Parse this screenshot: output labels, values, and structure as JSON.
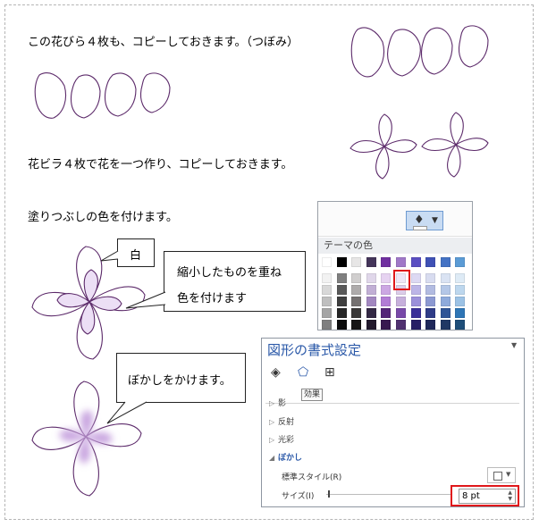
{
  "doc": {
    "line1": "この花びら４枚も、コピーしておきます。（つぼみ）",
    "line2": "花ビラ４枚で花を一つ作り、コピーしておきます。",
    "line3": "塗りつぶしの色を付けます。",
    "callout_white": "白",
    "callout_color_1": "縮小したものを重ね",
    "callout_color_2": "色を付けます",
    "callout_blur": "ぼかしをかけます。"
  },
  "palette": {
    "section_label": "テーマの色",
    "top_row": [
      "#ffffff",
      "#000000",
      "#e7e6e6",
      "#44355a",
      "#7030a0",
      "#a078c8",
      "#5b4fc2",
      "#3f51b5",
      "#4472c4",
      "#5b9bd5"
    ],
    "columns": [
      [
        "#f2f2f2",
        "#d8d8d8",
        "#bfbfbf",
        "#a5a5a5",
        "#7f7f7f"
      ],
      [
        "#7f7f7f",
        "#595959",
        "#3f3f3f",
        "#262626",
        "#0c0c0c"
      ],
      [
        "#d0cece",
        "#aeabab",
        "#757171",
        "#3a3838",
        "#171616"
      ],
      [
        "#e0d7ea",
        "#c1afd5",
        "#a287c0",
        "#332844",
        "#221a2d"
      ],
      [
        "#e6d3f1",
        "#cca7e3",
        "#b27cd5",
        "#542478",
        "#381850"
      ],
      [
        "#eee6f6",
        "#dccde9",
        "#c7b0dc",
        "#7849a8",
        "#503170"
      ],
      [
        "#ddd9f3",
        "#bcb5e7",
        "#9b90da",
        "#3a2f98",
        "#271f65"
      ],
      [
        "#d8dcf0",
        "#b2bbe1",
        "#8c99d2",
        "#2f3c87",
        "#1f285a"
      ],
      [
        "#dae3f3",
        "#b4c7e7",
        "#8eaadb",
        "#2f5496",
        "#1f3864"
      ],
      [
        "#deebf6",
        "#bdd7ee",
        "#9cc2e5",
        "#2e75b5",
        "#1e4e79"
      ]
    ]
  },
  "pane": {
    "title": "図形の書式設定",
    "tooltip": "効果",
    "sections": [
      "影",
      "反射",
      "光彩"
    ],
    "blur_header": "ぼかし",
    "preset_label": "標準スタイル(R)",
    "size_label": "サイズ(I)",
    "size_value": "8 pt",
    "tab_icons": [
      "fill-line-icon",
      "effects-pentagon-icon",
      "size-properties-icon"
    ]
  },
  "colors": {
    "outline": "#5c2a6a",
    "fill_light": "#ecdff5",
    "highlight": "#e0181b",
    "accent_blue": "#2a58a8"
  }
}
